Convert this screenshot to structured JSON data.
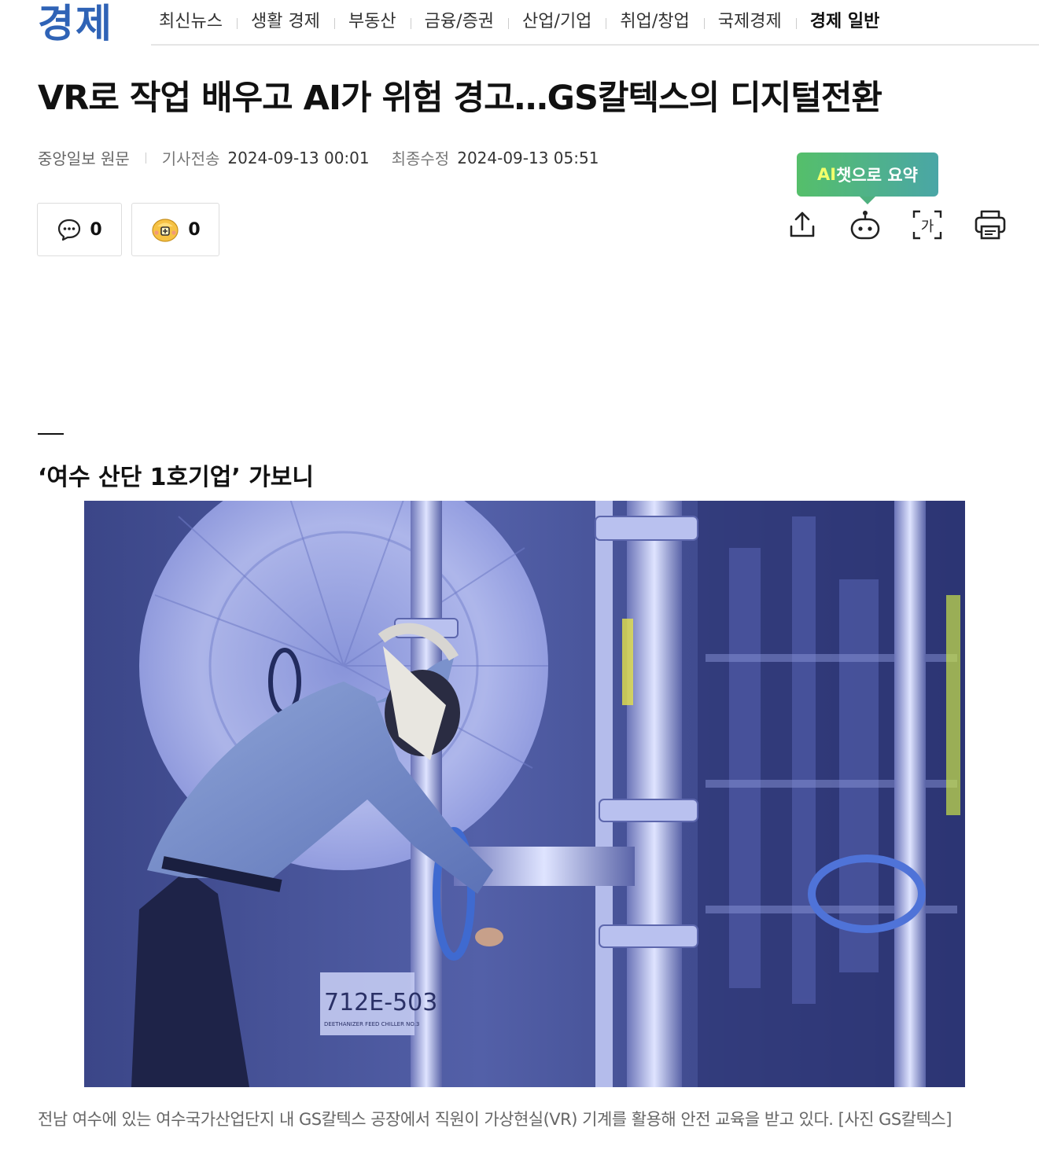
{
  "header": {
    "section_title": "경제",
    "nav": [
      {
        "label": "최신뉴스",
        "active": false
      },
      {
        "label": "생활 경제",
        "active": false
      },
      {
        "label": "부동산",
        "active": false
      },
      {
        "label": "금융/증권",
        "active": false
      },
      {
        "label": "산업/기업",
        "active": false
      },
      {
        "label": "취업/창업",
        "active": false
      },
      {
        "label": "국제경제",
        "active": false
      },
      {
        "label": "경제 일반",
        "active": true
      }
    ]
  },
  "article": {
    "headline": "VR로 작업 배우고 AI가 위험 경고…GS칼텍스의 디지털전환",
    "source": "중앙일보 원문",
    "sent_label": "기사전송",
    "sent_time": "2024-09-13 00:01",
    "modified_label": "최종수정",
    "modified_time": "2024-09-13 05:51",
    "subheading": "‘여수 산단 1호기업’ 가보니",
    "photo": {
      "equipment_label": "712E-503",
      "equipment_sublabel": "DEETHANIZER FEED CHILLER NO.3"
    },
    "caption": "전남 여수에 있는 여수국가산업단지 내 GS칼텍스 공장에서 직원이 가상현실(VR) 기계를 활용해 안전 교육을 받고 있다. [사진 GS칼텍스]"
  },
  "reactions": {
    "comments_count": "0",
    "likes_count": "0"
  },
  "tools": {
    "ai_summary_accent": "AI",
    "ai_summary_rest": "챗으로 요약",
    "font_icon_text": "가"
  },
  "colors": {
    "section_blue": "#2f63b6",
    "ai_bubble_start": "#55bf6a",
    "ai_bubble_end": "#4aa6a6",
    "ai_accent": "#f3ff6b"
  }
}
